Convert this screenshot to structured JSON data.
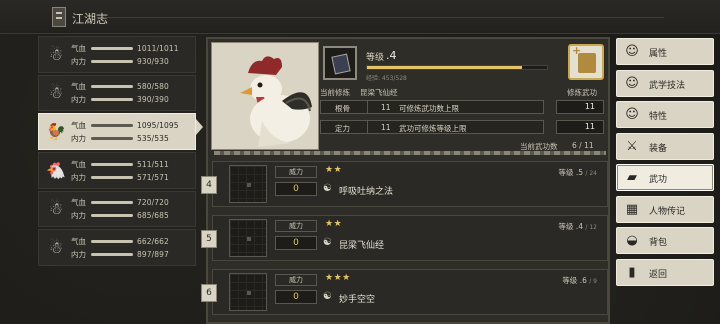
{
  "header": {
    "title": "江湖志"
  },
  "characters": [
    {
      "avatar": "☃",
      "hp_label": "气血",
      "hp": "1011/1011",
      "mp_label": "内力",
      "mp": "930/930"
    },
    {
      "avatar": "☃",
      "hp_label": "气血",
      "hp": "580/580",
      "mp_label": "内力",
      "mp": "390/390"
    },
    {
      "avatar": "🐓",
      "hp_label": "气血",
      "hp": "1095/1095",
      "mp_label": "内力",
      "mp": "535/535"
    },
    {
      "avatar": "🐔",
      "hp_label": "气血",
      "hp": "511/511",
      "mp_label": "内力",
      "mp": "571/571"
    },
    {
      "avatar": "☃",
      "hp_label": "气血",
      "hp": "720/720",
      "mp_label": "内力",
      "mp": "685/685"
    },
    {
      "avatar": "☃",
      "hp_label": "气血",
      "hp": "662/662",
      "mp_label": "内力",
      "mp": "897/897"
    }
  ],
  "selected_index": 2,
  "detail": {
    "level_label": "等级",
    "level": ".4",
    "exp_text": "经验: 453/528",
    "level_progress": 0.86,
    "current_label": "当前修炼",
    "current_skill": "昆梁飞仙经",
    "cultivate_label": "修炼武功",
    "attr1_name": "根骨",
    "attr1_num": "11",
    "attr1_desc": "可修炼武功数上限",
    "attr1_value": "11",
    "attr2_name": "定力",
    "attr2_num": "11",
    "attr2_desc": "武功可修炼等级上限",
    "attr2_value": "11",
    "count_label": "当前武功数",
    "count_value": "6 / 11"
  },
  "skills": [
    {
      "num": "4",
      "power_label": "威力",
      "power": "0",
      "stars": "★★",
      "name": "呼吸吐纳之法",
      "level": "等级 .5",
      "max": "/ 24"
    },
    {
      "num": "5",
      "power_label": "威力",
      "power": "0",
      "stars": "★★",
      "name": "昆梁飞仙经",
      "level": "等级 .4",
      "max": "/ 12"
    },
    {
      "num": "6",
      "power_label": "威力",
      "power": "0",
      "stars": "★★★",
      "name": "妙手空空",
      "level": "等级 .6",
      "max": "/ 9"
    }
  ],
  "menu": [
    {
      "icon": "☺",
      "label": "属性"
    },
    {
      "icon": "☺",
      "label": "武学技法"
    },
    {
      "icon": "☺",
      "label": "特性"
    },
    {
      "icon": "⚔",
      "label": "装备"
    },
    {
      "icon": "▰",
      "label": "武功"
    },
    {
      "icon": "▦",
      "label": "人物传记"
    },
    {
      "icon": "◒",
      "label": "背包"
    },
    {
      "icon": "▮",
      "label": "返回"
    }
  ]
}
